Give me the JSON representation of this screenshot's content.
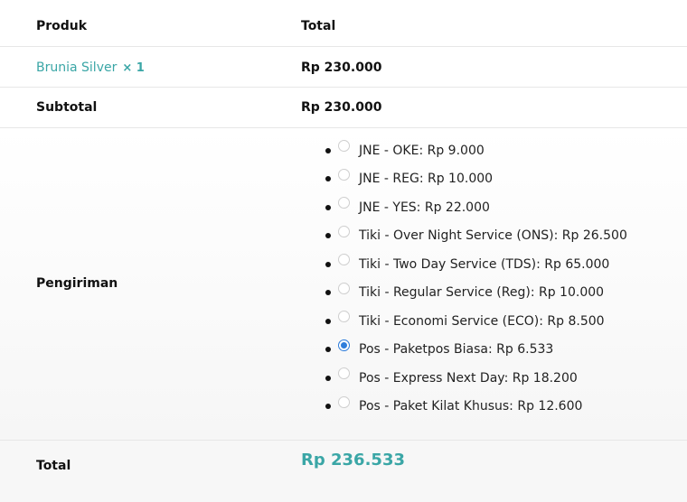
{
  "table": {
    "header": {
      "product": "Produk",
      "total": "Total"
    },
    "item": {
      "name": "Brunia Silver",
      "qty": "× 1",
      "total": "Rp 230.000"
    },
    "subtotal": {
      "label": "Subtotal",
      "value": "Rp 230.000"
    },
    "shipping": {
      "label": "Pengiriman",
      "options": [
        {
          "label": "JNE - OKE: Rp 9.000",
          "selected": false
        },
        {
          "label": "JNE - REG: Rp 10.000",
          "selected": false
        },
        {
          "label": "JNE - YES: Rp 22.000",
          "selected": false
        },
        {
          "label": "Tiki - Over Night Service (ONS): Rp 26.500",
          "selected": false
        },
        {
          "label": "Tiki - Two Day Service (TDS): Rp 65.000",
          "selected": false
        },
        {
          "label": "Tiki - Regular Service (Reg): Rp 10.000",
          "selected": false
        },
        {
          "label": "Tiki - Economi Service (ECO): Rp 8.500",
          "selected": false
        },
        {
          "label": "Pos - Paketpos Biasa: Rp 6.533",
          "selected": true
        },
        {
          "label": "Pos - Express Next Day: Rp 18.200",
          "selected": false
        },
        {
          "label": "Pos - Paket Kilat Khusus: Rp 12.600",
          "selected": false
        }
      ]
    },
    "total": {
      "label": "Total",
      "value": "Rp 236.533"
    }
  },
  "colors": {
    "accent": "#3aa6a6",
    "radio_selected": "#2f7ddb",
    "border": "#e7e7e7"
  }
}
